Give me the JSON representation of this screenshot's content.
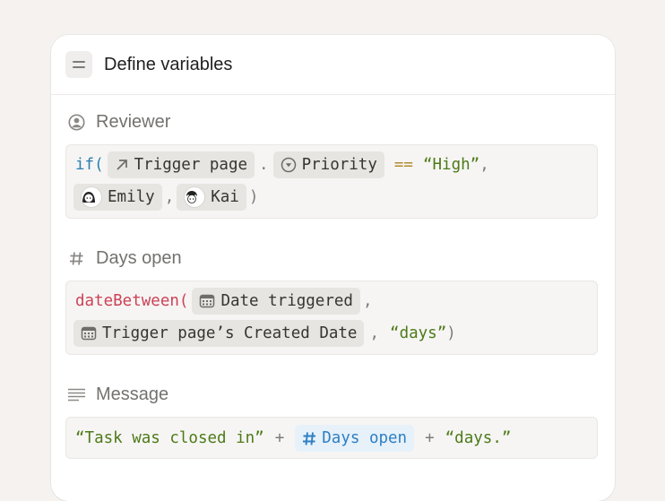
{
  "card": {
    "title": "Define variables",
    "icon": "equals-icon"
  },
  "sections": {
    "reviewer": {
      "label": "Reviewer",
      "icon": "person-circle-icon",
      "tokens": {
        "fn": "if(",
        "trigger_chip": "Trigger page",
        "dot": ".",
        "priority_chip": "Priority",
        "op": "==",
        "value": "“High”",
        "comma1": ",",
        "person1": "Emily",
        "comma2": ",",
        "person2": "Kai",
        "close": ")"
      }
    },
    "days_open": {
      "label": "Days open",
      "icon": "hash-icon",
      "tokens": {
        "fn": "dateBetween(",
        "date_chip": "Date triggered",
        "comma1": ",",
        "created_chip": "Trigger page’s Created Date",
        "comma2": ",",
        "unit": "“days”",
        "close": ")"
      }
    },
    "message": {
      "label": "Message",
      "icon": "text-lines-icon",
      "tokens": {
        "str1": "“Task was closed in”",
        "plus1": "+",
        "var_chip": "Days open",
        "plus2": "+",
        "str2": "“days.”"
      }
    }
  },
  "colors": {
    "background": "#f5f2ef",
    "card": "#ffffff",
    "keyword": "#2b7fb0",
    "function": "#cc4257",
    "string": "#4d7a18",
    "operator": "#b08a2e",
    "variable_chip": "#2e7fc4"
  }
}
